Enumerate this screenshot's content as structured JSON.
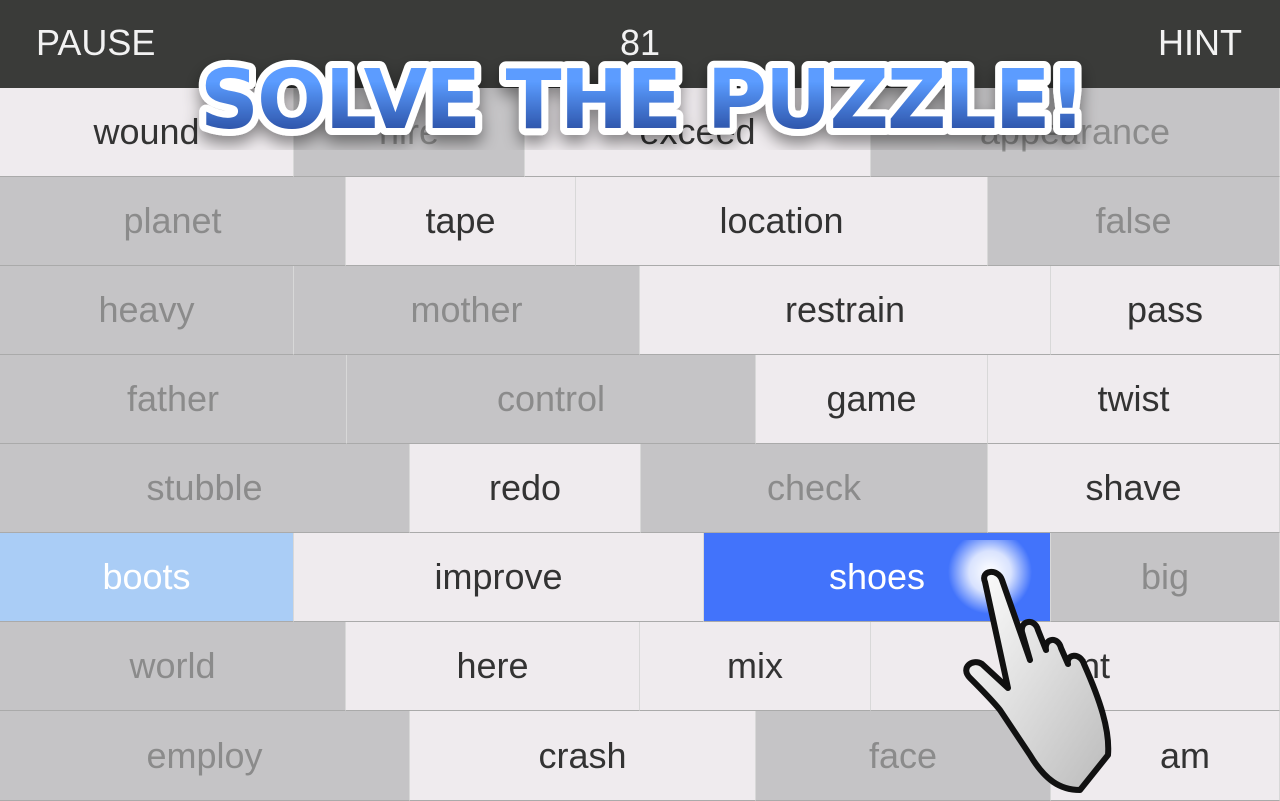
{
  "topbar": {
    "pause": "PAUSE",
    "score": "81",
    "hint": "HINT"
  },
  "banner": {
    "text": "SOLVE THE PUZZLE!"
  },
  "colors": {
    "topbar": "#3a3b39",
    "cell_light": "#efebee",
    "cell_gray": "#c5c4c6",
    "selected": "#4273fb",
    "selected_previous": "#aacdf6"
  },
  "rows": [
    [
      {
        "w": "wound",
        "s": "light"
      },
      {
        "w": "hire",
        "s": "gray"
      },
      {
        "w": "exceed",
        "s": "light"
      },
      {
        "w": "appearance",
        "s": "gray"
      }
    ],
    [
      {
        "w": "planet",
        "s": "gray"
      },
      {
        "w": "tape",
        "s": "light"
      },
      {
        "w": "location",
        "s": "light"
      },
      {
        "w": "false",
        "s": "gray"
      }
    ],
    [
      {
        "w": "heavy",
        "s": "gray"
      },
      {
        "w": "mother",
        "s": "gray"
      },
      {
        "w": "restrain",
        "s": "light"
      },
      {
        "w": "pass",
        "s": "light"
      }
    ],
    [
      {
        "w": "father",
        "s": "gray"
      },
      {
        "w": "control",
        "s": "gray"
      },
      {
        "w": "game",
        "s": "light"
      },
      {
        "w": "twist",
        "s": "light"
      }
    ],
    [
      {
        "w": "stubble",
        "s": "gray"
      },
      {
        "w": "redo",
        "s": "light"
      },
      {
        "w": "check",
        "s": "gray"
      },
      {
        "w": "shave",
        "s": "light"
      }
    ],
    [
      {
        "w": "boots",
        "s": "sel-light"
      },
      {
        "w": "improve",
        "s": "light"
      },
      {
        "w": "shoes",
        "s": "sel"
      },
      {
        "w": "big",
        "s": "gray"
      }
    ],
    [
      {
        "w": "world",
        "s": "gray"
      },
      {
        "w": "here",
        "s": "light"
      },
      {
        "w": "mix",
        "s": "light"
      },
      {
        "w": "nt",
        "s": "light"
      }
    ],
    [
      {
        "w": "employ",
        "s": "gray"
      },
      {
        "w": "crash",
        "s": "light"
      },
      {
        "w": "face",
        "s": "gray"
      },
      {
        "w": "am",
        "s": "light"
      }
    ]
  ],
  "pointer_icon": "hand-pointer-icon"
}
